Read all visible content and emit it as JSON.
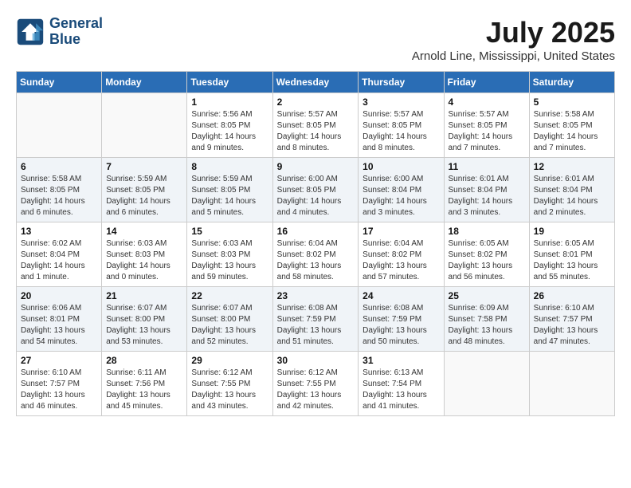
{
  "header": {
    "logo_line1": "General",
    "logo_line2": "Blue",
    "month": "July 2025",
    "location": "Arnold Line, Mississippi, United States"
  },
  "weekdays": [
    "Sunday",
    "Monday",
    "Tuesday",
    "Wednesday",
    "Thursday",
    "Friday",
    "Saturday"
  ],
  "weeks": [
    [
      {
        "day": "",
        "info": ""
      },
      {
        "day": "",
        "info": ""
      },
      {
        "day": "1",
        "info": "Sunrise: 5:56 AM\nSunset: 8:05 PM\nDaylight: 14 hours and 9 minutes."
      },
      {
        "day": "2",
        "info": "Sunrise: 5:57 AM\nSunset: 8:05 PM\nDaylight: 14 hours and 8 minutes."
      },
      {
        "day": "3",
        "info": "Sunrise: 5:57 AM\nSunset: 8:05 PM\nDaylight: 14 hours and 8 minutes."
      },
      {
        "day": "4",
        "info": "Sunrise: 5:57 AM\nSunset: 8:05 PM\nDaylight: 14 hours and 7 minutes."
      },
      {
        "day": "5",
        "info": "Sunrise: 5:58 AM\nSunset: 8:05 PM\nDaylight: 14 hours and 7 minutes."
      }
    ],
    [
      {
        "day": "6",
        "info": "Sunrise: 5:58 AM\nSunset: 8:05 PM\nDaylight: 14 hours and 6 minutes."
      },
      {
        "day": "7",
        "info": "Sunrise: 5:59 AM\nSunset: 8:05 PM\nDaylight: 14 hours and 6 minutes."
      },
      {
        "day": "8",
        "info": "Sunrise: 5:59 AM\nSunset: 8:05 PM\nDaylight: 14 hours and 5 minutes."
      },
      {
        "day": "9",
        "info": "Sunrise: 6:00 AM\nSunset: 8:05 PM\nDaylight: 14 hours and 4 minutes."
      },
      {
        "day": "10",
        "info": "Sunrise: 6:00 AM\nSunset: 8:04 PM\nDaylight: 14 hours and 3 minutes."
      },
      {
        "day": "11",
        "info": "Sunrise: 6:01 AM\nSunset: 8:04 PM\nDaylight: 14 hours and 3 minutes."
      },
      {
        "day": "12",
        "info": "Sunrise: 6:01 AM\nSunset: 8:04 PM\nDaylight: 14 hours and 2 minutes."
      }
    ],
    [
      {
        "day": "13",
        "info": "Sunrise: 6:02 AM\nSunset: 8:04 PM\nDaylight: 14 hours and 1 minute."
      },
      {
        "day": "14",
        "info": "Sunrise: 6:03 AM\nSunset: 8:03 PM\nDaylight: 14 hours and 0 minutes."
      },
      {
        "day": "15",
        "info": "Sunrise: 6:03 AM\nSunset: 8:03 PM\nDaylight: 13 hours and 59 minutes."
      },
      {
        "day": "16",
        "info": "Sunrise: 6:04 AM\nSunset: 8:02 PM\nDaylight: 13 hours and 58 minutes."
      },
      {
        "day": "17",
        "info": "Sunrise: 6:04 AM\nSunset: 8:02 PM\nDaylight: 13 hours and 57 minutes."
      },
      {
        "day": "18",
        "info": "Sunrise: 6:05 AM\nSunset: 8:02 PM\nDaylight: 13 hours and 56 minutes."
      },
      {
        "day": "19",
        "info": "Sunrise: 6:05 AM\nSunset: 8:01 PM\nDaylight: 13 hours and 55 minutes."
      }
    ],
    [
      {
        "day": "20",
        "info": "Sunrise: 6:06 AM\nSunset: 8:01 PM\nDaylight: 13 hours and 54 minutes."
      },
      {
        "day": "21",
        "info": "Sunrise: 6:07 AM\nSunset: 8:00 PM\nDaylight: 13 hours and 53 minutes."
      },
      {
        "day": "22",
        "info": "Sunrise: 6:07 AM\nSunset: 8:00 PM\nDaylight: 13 hours and 52 minutes."
      },
      {
        "day": "23",
        "info": "Sunrise: 6:08 AM\nSunset: 7:59 PM\nDaylight: 13 hours and 51 minutes."
      },
      {
        "day": "24",
        "info": "Sunrise: 6:08 AM\nSunset: 7:59 PM\nDaylight: 13 hours and 50 minutes."
      },
      {
        "day": "25",
        "info": "Sunrise: 6:09 AM\nSunset: 7:58 PM\nDaylight: 13 hours and 48 minutes."
      },
      {
        "day": "26",
        "info": "Sunrise: 6:10 AM\nSunset: 7:57 PM\nDaylight: 13 hours and 47 minutes."
      }
    ],
    [
      {
        "day": "27",
        "info": "Sunrise: 6:10 AM\nSunset: 7:57 PM\nDaylight: 13 hours and 46 minutes."
      },
      {
        "day": "28",
        "info": "Sunrise: 6:11 AM\nSunset: 7:56 PM\nDaylight: 13 hours and 45 minutes."
      },
      {
        "day": "29",
        "info": "Sunrise: 6:12 AM\nSunset: 7:55 PM\nDaylight: 13 hours and 43 minutes."
      },
      {
        "day": "30",
        "info": "Sunrise: 6:12 AM\nSunset: 7:55 PM\nDaylight: 13 hours and 42 minutes."
      },
      {
        "day": "31",
        "info": "Sunrise: 6:13 AM\nSunset: 7:54 PM\nDaylight: 13 hours and 41 minutes."
      },
      {
        "day": "",
        "info": ""
      },
      {
        "day": "",
        "info": ""
      }
    ]
  ]
}
